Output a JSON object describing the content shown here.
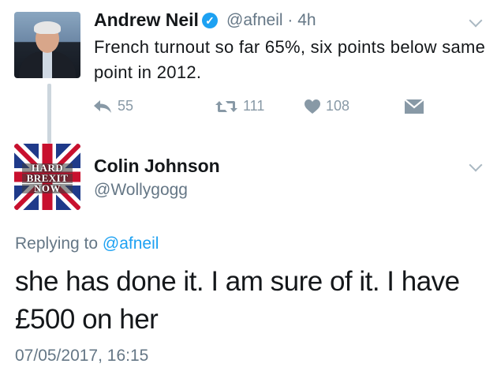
{
  "tweet": {
    "author_name": "Andrew Neil",
    "verified": true,
    "handle": "@afneil",
    "separator": "·",
    "time_ago": "4h",
    "text": "French turnout so far 65%, six points below same point in 2012.",
    "actions": {
      "reply_count": "55",
      "retweet_count": "111",
      "like_count": "108"
    }
  },
  "reply": {
    "author_name": "Colin Johnson",
    "handle": "@Wollygogg",
    "avatar_text": [
      "HARD",
      "BREXIT",
      "NOW"
    ],
    "replying_prefix": "Replying to",
    "replying_to": "@afneil",
    "text": "she has done it. I am sure of it. I have £500 on her",
    "timestamp": "07/05/2017, 16:15"
  },
  "colors": {
    "text": "#14171a",
    "secondary": "#657786",
    "icon": "#8899a6",
    "link": "#1da1f2",
    "verified": "#1da1f2"
  }
}
